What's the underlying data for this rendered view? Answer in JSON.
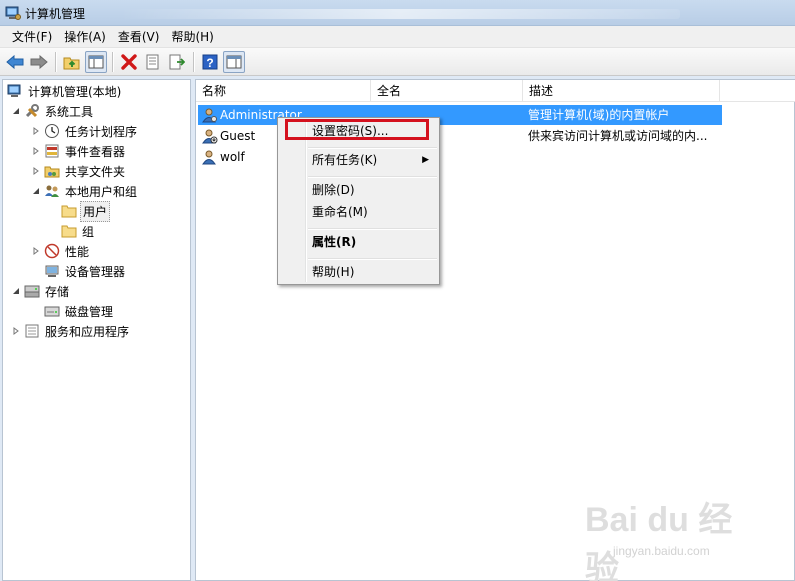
{
  "window": {
    "title": "计算机管理"
  },
  "menu": [
    "文件(F)",
    "操作(A)",
    "查看(V)",
    "帮助(H)"
  ],
  "toolbar": [
    "back-arrow-icon",
    "forward-arrow-icon",
    "up-folder-icon",
    "show-hide-tree-icon",
    "delete-icon",
    "properties-icon",
    "export-list-icon",
    "help-icon",
    "action-pane-icon"
  ],
  "tree": {
    "root": "计算机管理(本地)",
    "system_tools": "系统工具",
    "task_scheduler": "任务计划程序",
    "event_viewer": "事件查看器",
    "shared_folders": "共享文件夹",
    "local_users_groups": "本地用户和组",
    "users": "用户",
    "groups": "组",
    "performance": "性能",
    "device_manager": "设备管理器",
    "storage": "存储",
    "disk_management": "磁盘管理",
    "services_apps": "服务和应用程序"
  },
  "list": {
    "columns": [
      "名称",
      "全名",
      "描述"
    ],
    "rows": [
      {
        "name": "Administrator",
        "fullname": "",
        "description": "管理计算机(域)的内置帐户"
      },
      {
        "name": "Guest",
        "fullname": "",
        "description": "供来宾访问计算机或访问域的内..."
      },
      {
        "name": "wolf",
        "fullname": "",
        "description": ""
      }
    ]
  },
  "context_menu": {
    "set_password": "设置密码(S)...",
    "all_tasks": "所有任务(K)",
    "delete": "删除(D)",
    "rename": "重命名(M)",
    "properties": "属性(R)",
    "help": "帮助(H)"
  },
  "watermark": {
    "main": "Bai du 经验",
    "sub": "jingyan.baidu.com"
  },
  "colors": {
    "selection": "#3399ff",
    "highlight_box": "#d4111e"
  }
}
